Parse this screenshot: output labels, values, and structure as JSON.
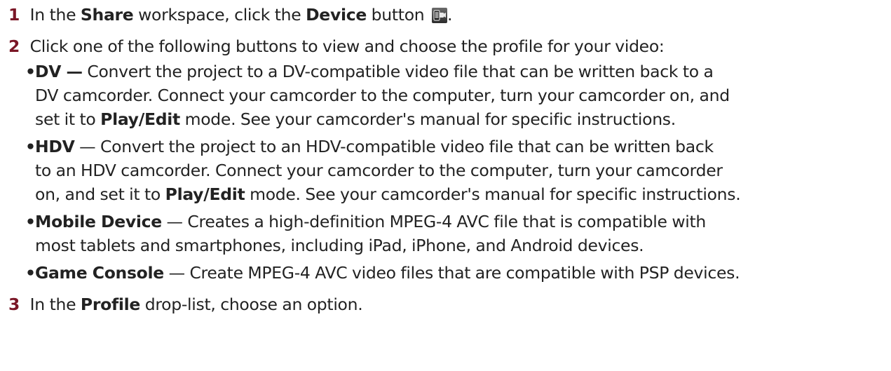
{
  "steps": [
    {
      "number": "1",
      "parts": [
        "In the ",
        "Share",
        " workspace, click the ",
        "Device",
        " button ",
        "."
      ],
      "icon": "device-button-icon"
    },
    {
      "number": "2",
      "text": "Click one of the following buttons to view and choose the profile for your video:"
    },
    {
      "number": "3",
      "parts": [
        "In the ",
        "Profile",
        " drop-list, choose an option."
      ]
    }
  ],
  "bullets": {
    "dv": {
      "term": "DV —",
      "lines": [
        " Convert the project to a DV-compatible video file that can be written back to a",
        "DV camcorder. Connect your camcorder to the computer, turn your camcorder on, and"
      ],
      "last_pre": "set it to ",
      "last_bold": "Play/Edit",
      "last_post": " mode. See your camcorder's manual for specific instructions."
    },
    "hdv": {
      "term": "HDV",
      "lines": [
        " — Convert the project to an HDV-compatible video file that can be written back",
        "to an HDV camcorder. Connect your camcorder to the computer, turn your camcorder"
      ],
      "last_pre": "on, and set it to ",
      "last_bold": "Play/Edit",
      "last_post": " mode. See your camcorder's manual for specific instructions."
    },
    "mobile": {
      "term": "Mobile Device",
      "lines": [
        " — Creates a high-definition MPEG-4 AVC file that is compatible with",
        "most tablets and smartphones, including iPad, iPhone, and Android devices."
      ]
    },
    "game": {
      "term": "Game Console",
      "lines": [
        " — Create MPEG-4 AVC video files that are compatible with PSP devices."
      ]
    }
  },
  "colors": {
    "step_number": "#7a1626",
    "text": "#222222"
  }
}
